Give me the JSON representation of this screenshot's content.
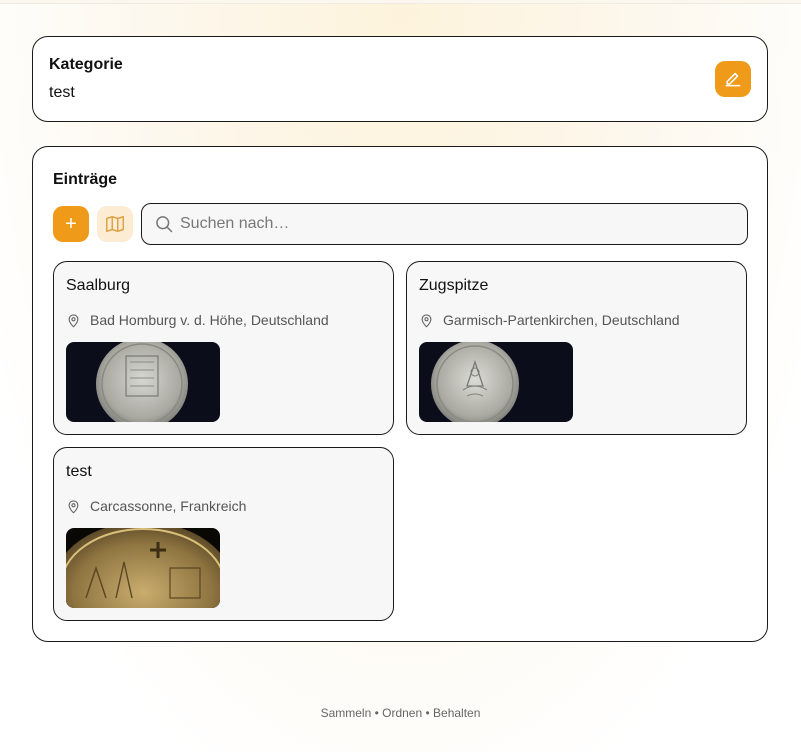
{
  "category": {
    "label": "Kategorie",
    "value": "test"
  },
  "entries_section": {
    "title": "Einträge",
    "add_label": "+",
    "search_placeholder": "Suchen nach…"
  },
  "entries": [
    {
      "name": "Saalburg",
      "location": "Bad Homburg v. d. Höhe, Deutschland",
      "image": "silver-coin-photo"
    },
    {
      "name": "Zugspitze",
      "location": "Garmisch-Partenkirchen, Deutschland",
      "image": "silver-coin-photo"
    },
    {
      "name": "test",
      "location": "Carcassonne, Frankreich",
      "image": "gold-coin-photo"
    }
  ],
  "footer": {
    "tagline": "Sammeln • Ordnen • Behalten"
  },
  "colors": {
    "accent": "#f09a1a",
    "accent_light": "#fbecd3",
    "border": "#1b1b1b"
  },
  "icons": [
    "pencil-icon",
    "map-icon",
    "search-icon",
    "map-pin-icon"
  ]
}
